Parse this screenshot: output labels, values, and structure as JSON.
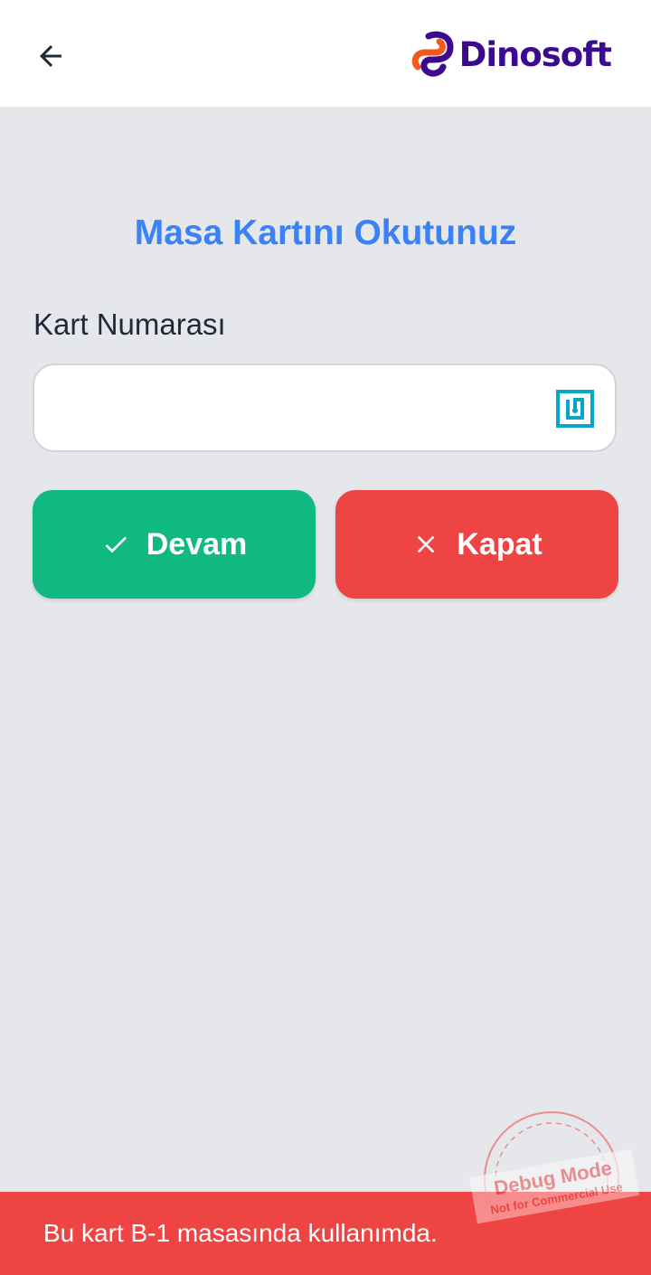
{
  "header": {
    "back_icon": "arrow-left-icon",
    "logo_text": "Dinosoft"
  },
  "main": {
    "title": "Masa Kartını Okutunuz",
    "card_field": {
      "label": "Kart Numarası",
      "value": "",
      "placeholder": "",
      "trailing_icon": "nfc-icon"
    },
    "buttons": {
      "confirm_label": "Devam",
      "confirm_icon": "check-icon",
      "close_label": "Kapat",
      "close_icon": "close-icon"
    }
  },
  "snackbar": {
    "message": "Bu kart B-1 masasında kullanımda."
  },
  "debug_stamp": {
    "title": "Debug Mode",
    "subtitle": "Not for Commercial Use"
  },
  "colors": {
    "accent_blue": "#3b82f6",
    "success_green": "#10b981",
    "danger_red": "#ef4444",
    "brand_purple": "#3b0a8f",
    "brand_orange": "#f05a1a",
    "nfc_icon": "#06a7c6"
  }
}
